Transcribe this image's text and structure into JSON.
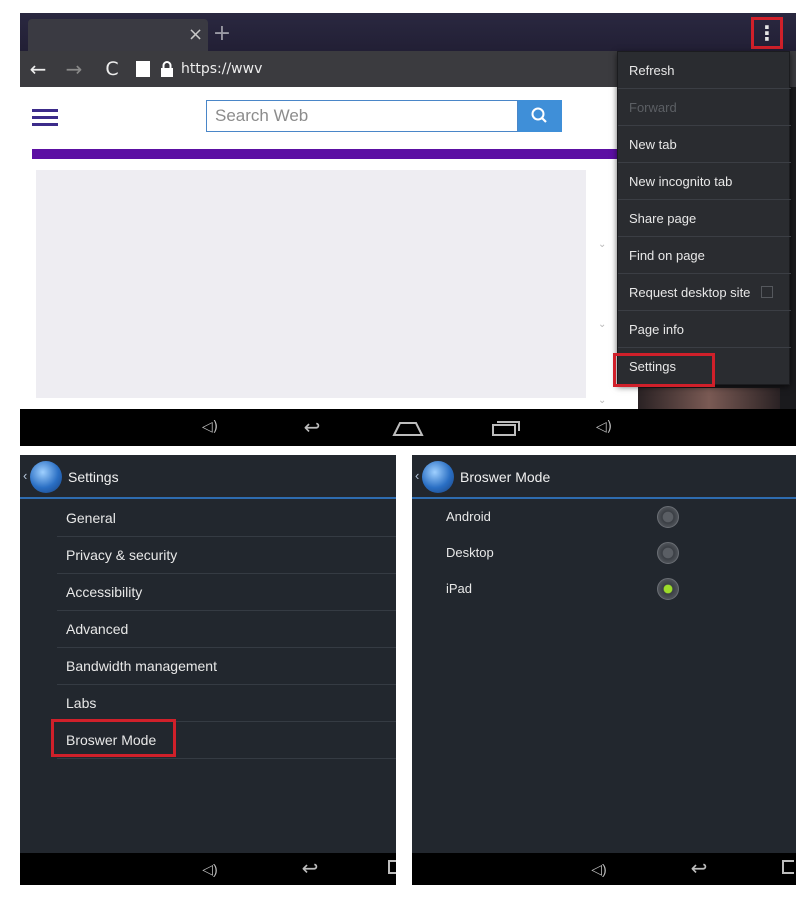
{
  "browser": {
    "tab_close": "×",
    "new_tab_symbol": "+",
    "menu_symbol": "⋮",
    "url": "https://wwv",
    "search_placeholder": "Search Web",
    "menu_items": [
      {
        "label": "Refresh",
        "disabled": false
      },
      {
        "label": "Forward",
        "disabled": true
      },
      {
        "label": "New tab",
        "disabled": false
      },
      {
        "label": "New incognito tab",
        "disabled": false
      },
      {
        "label": "Share page",
        "disabled": false
      },
      {
        "label": "Find on page",
        "disabled": false
      },
      {
        "label": "Request desktop site",
        "disabled": false,
        "checkbox": true,
        "checked": false
      },
      {
        "label": "Page info",
        "disabled": false
      },
      {
        "label": "Settings",
        "disabled": false,
        "highlighted": true
      }
    ]
  },
  "settings": {
    "title": "Settings",
    "items": [
      "General",
      "Privacy & security",
      "Accessibility",
      "Advanced",
      "Bandwidth management",
      "Labs",
      "Broswer Mode"
    ],
    "highlighted_item": "Broswer Mode"
  },
  "browser_mode": {
    "title": "Broswer Mode",
    "options": [
      {
        "label": "Android",
        "selected": false
      },
      {
        "label": "Desktop",
        "selected": false
      },
      {
        "label": "iPad",
        "selected": true
      }
    ]
  },
  "colors": {
    "highlight_red": "#d0202a",
    "accent_blue": "#2e6cb0",
    "radio_selected": "#9ddc2a",
    "page_purple": "#5c0fa3"
  }
}
